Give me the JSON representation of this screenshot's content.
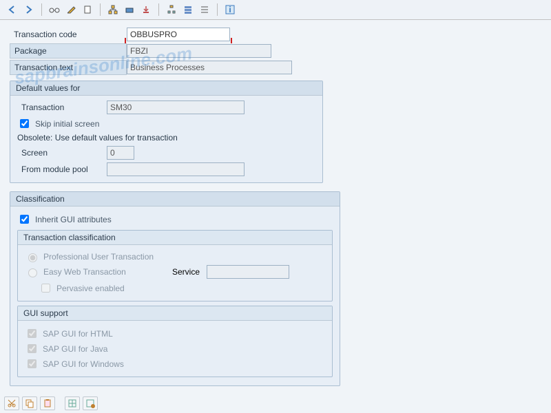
{
  "header": {
    "transaction_code_label": "Transaction code",
    "transaction_code_value": "OBBUSPRO",
    "package_label": "Package",
    "package_value": "FBZI",
    "transaction_text_label": "Transaction text",
    "transaction_text_value": "Business Processes"
  },
  "defaults": {
    "title": "Default values for",
    "transaction_label": "Transaction",
    "transaction_value": "SM30",
    "skip_initial_label": "Skip initial screen",
    "skip_initial_checked": true,
    "obsolete_text": "Obsolete: Use default values for transaction",
    "screen_label": "Screen",
    "screen_value": "0",
    "from_module_pool_label": "From module pool",
    "from_module_pool_value": ""
  },
  "classification": {
    "title": "Classification",
    "inherit_label": "Inherit GUI attributes",
    "inherit_checked": true,
    "tc": {
      "title": "Transaction classification",
      "prof_label": "Professional User Transaction",
      "prof_selected": true,
      "easy_label": "Easy Web Transaction",
      "easy_selected": false,
      "service_label": "Service",
      "service_value": "",
      "pervasive_label": "Pervasive enabled",
      "pervasive_checked": false
    },
    "gui": {
      "title": "GUI support",
      "html_label": "SAP GUI for HTML",
      "html_checked": true,
      "java_label": "SAP GUI for Java",
      "java_checked": true,
      "win_label": "SAP GUI for Windows",
      "win_checked": true
    }
  },
  "watermark": "sapbrainsonline.com"
}
